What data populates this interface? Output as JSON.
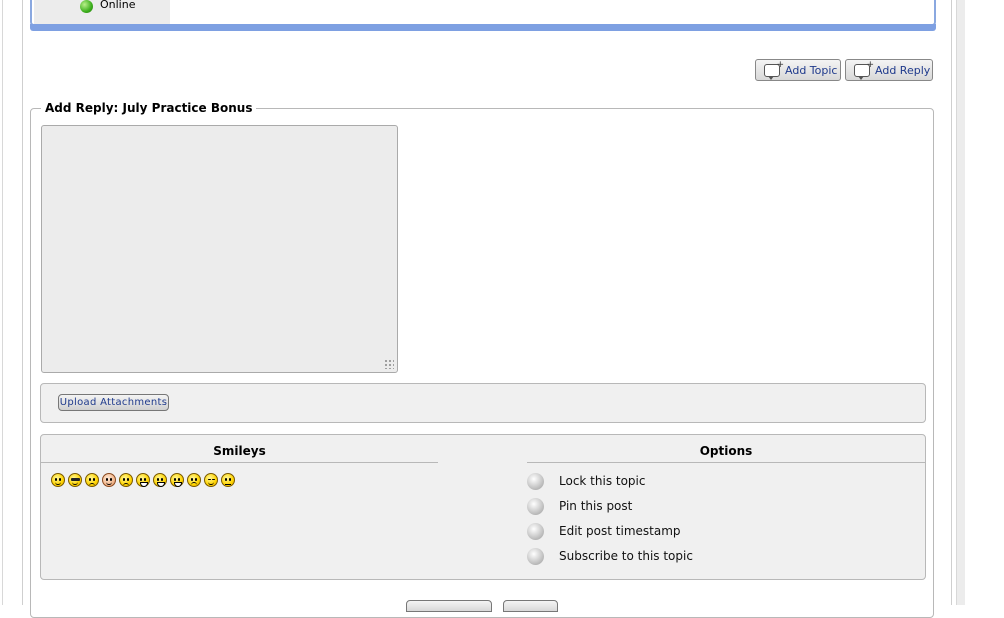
{
  "post": {
    "status_text": "Online"
  },
  "toolbar": {
    "add_topic_label": "Add Topic",
    "add_reply_label": "Add Reply"
  },
  "reply_form": {
    "legend": "Add Reply: July Practice Bonus",
    "upload_label": "Upload Attachments",
    "smileys_heading": "Smileys",
    "options_heading": "Options",
    "smileys": [
      "smile-icon",
      "cool-icon",
      "sad-icon",
      "pale-icon",
      "confused-icon",
      "grin-icon",
      "laugh-icon",
      "big-smile-icon",
      "frown-icon",
      "wink-icon",
      "flat-face-icon"
    ],
    "options": [
      {
        "label": "Lock this topic"
      },
      {
        "label": "Pin this post"
      },
      {
        "label": "Edit post timestamp"
      },
      {
        "label": "Subscribe to this topic"
      }
    ]
  },
  "colors": {
    "accent_bar": "#7ea0e2",
    "button_text": "#1f3a8c",
    "panel_bg": "#f0f0f0"
  }
}
